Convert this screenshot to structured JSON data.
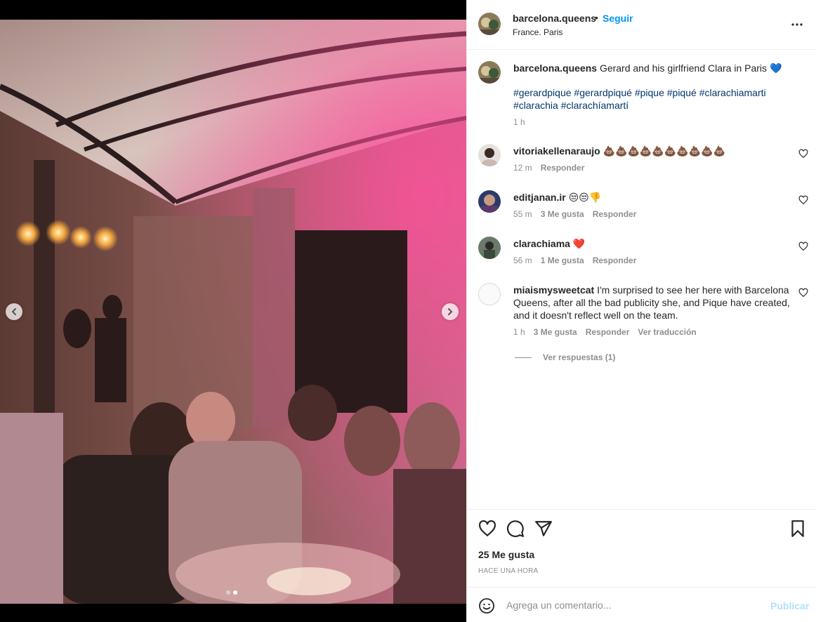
{
  "colors": {
    "accent": "#0095f6",
    "text": "#262626",
    "muted": "#8e8e8e",
    "hashtag": "#00376b",
    "publish_disabled": "#b2dffc"
  },
  "post": {
    "author": "barcelona.queens",
    "separator": "•",
    "follow_label": "Seguir",
    "location": "France. Paris",
    "more_icon": "more-horizontal-icon"
  },
  "caption": {
    "author": "barcelona.queens",
    "text": "Gerard and his girlfriend Clara in Paris",
    "emoji": "💙",
    "hashtags": [
      "#gerardpique",
      "#gerardpiqué",
      "#pique",
      "#piqué",
      "#clarachiamarti",
      "#clarachia",
      "#clarachíamartí"
    ],
    "time": "1 h"
  },
  "comments": [
    {
      "user": "vitoriakellenaraujo",
      "text": "💩💩💩💩💩💩💩💩💩💩",
      "time": "12 m",
      "likes": "",
      "reply": "Responder"
    },
    {
      "user": "editjanan.ir",
      "text": "😒😒👎",
      "time": "55 m",
      "likes": "3 Me gusta",
      "reply": "Responder"
    },
    {
      "user": "clarachiama",
      "text": "❤️",
      "time": "56 m",
      "likes": "1 Me gusta",
      "reply": "Responder"
    },
    {
      "user": "miaismysweetcat",
      "text": "I'm surprised to see her here with Barcelona Queens, after all the bad publicity she, and Pique have created, and it doesn't reflect well on the team.",
      "time": "1 h",
      "likes": "3 Me gusta",
      "reply": "Responder",
      "translate": "Ver traducción"
    }
  ],
  "view_replies": "Ver respuestas (1)",
  "likes_count": "25 Me gusta",
  "posted_ago": "HACE UNA HORA",
  "composer": {
    "placeholder": "Agrega un comentario...",
    "publish": "Publicar"
  },
  "carousel": {
    "count": 2,
    "active_index": 1
  }
}
